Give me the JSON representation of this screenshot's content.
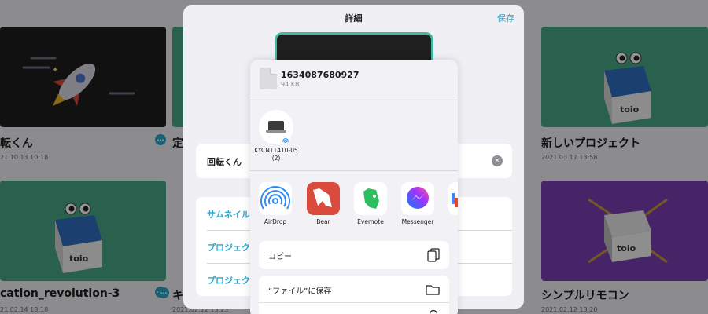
{
  "background_projects": {
    "items": [
      {
        "title": "転くん",
        "date": "21.10.13 10:18"
      },
      {
        "title": "定",
        "date": ""
      },
      {
        "title": "新しいプロジェクト",
        "date": "2021.03.17 13:58"
      },
      {
        "title": "cation_revolution-3",
        "date": "21.02.14 18:18"
      },
      {
        "title": "キ",
        "date": "2021.02.12 13:23"
      },
      {
        "title": "シンプルリモコン",
        "date": "2021.02.12 13:20"
      }
    ],
    "toio_label": "toio"
  },
  "detail_sheet": {
    "title": "詳細",
    "save_label": "保存",
    "name_value": "回転くん",
    "options": [
      "サムネイル",
      "プロジェク",
      "プロジェク"
    ]
  },
  "share_sheet": {
    "file_name": "1634087680927",
    "file_size": "94 KB",
    "airdrop_device": "KYCNT1410-05 (2)",
    "apps": [
      {
        "label": "AirDrop",
        "icon": "airdrop-icon"
      },
      {
        "label": "Bear",
        "icon": "bear-icon"
      },
      {
        "label": "Evernote",
        "icon": "evernote-icon"
      },
      {
        "label": "Messenger",
        "icon": "messenger-icon"
      },
      {
        "label": "",
        "icon": "partial-app-icon"
      }
    ],
    "actions": [
      {
        "label": "コピー",
        "icon": "copy-icon"
      },
      {
        "label": "“ファイル”に保存",
        "icon": "folder-icon"
      }
    ]
  },
  "colors": {
    "accent": "#2aa7c9",
    "toio_blue": "#2f6fbf",
    "green_card": "#49a887",
    "purple_card": "#7a3fb3"
  }
}
